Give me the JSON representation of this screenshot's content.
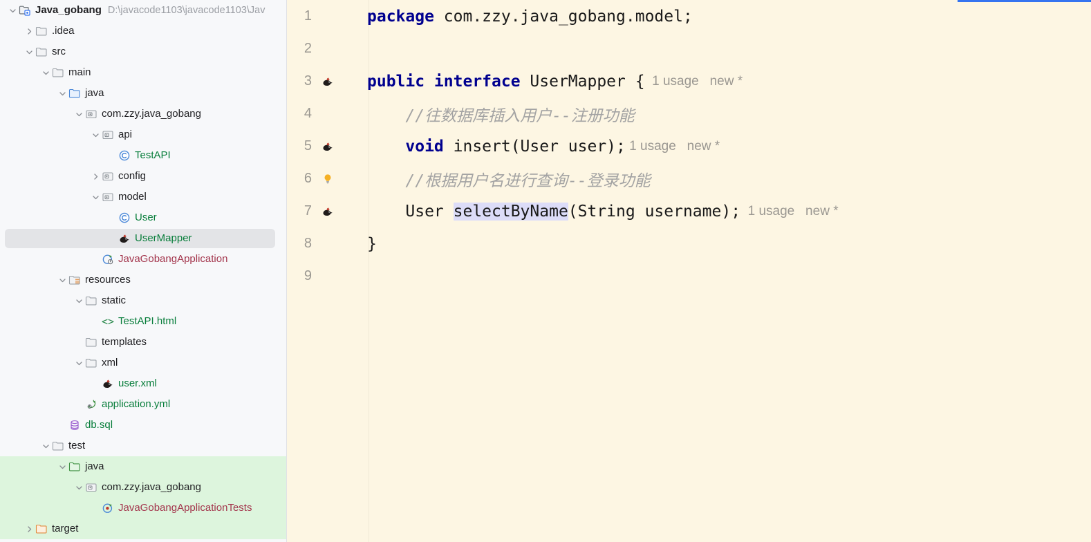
{
  "window": {
    "theme_accent": "#3574f0",
    "editor_background": "#fdf6e3",
    "sidebar_background": "#f7f8fa",
    "selection_background": "#e3e4e7",
    "test_scope_background": "#ddf5dd",
    "identifier_highlight": "#dcdcf8"
  },
  "sidebar": {
    "name": "project-tool-window",
    "items": [
      {
        "label": "Java_gobang",
        "path": "D:\\javacode1103\\javacode1103\\Jav",
        "icon": "project-module-icon",
        "indent": 0,
        "arrow": "expanded",
        "bold": true,
        "color": "#1f1f22",
        "selected": false,
        "testscope": false
      },
      {
        "label": ".idea",
        "path": "",
        "icon": "folder-icon",
        "indent": 1,
        "arrow": "collapsed",
        "bold": false,
        "color": "#1f1f22",
        "selected": false,
        "testscope": false
      },
      {
        "label": "src",
        "path": "",
        "icon": "folder-icon",
        "indent": 1,
        "arrow": "expanded",
        "bold": false,
        "color": "#1f1f22",
        "selected": false,
        "testscope": false
      },
      {
        "label": "main",
        "path": "",
        "icon": "folder-icon",
        "indent": 2,
        "arrow": "expanded",
        "bold": false,
        "color": "#1f1f22",
        "selected": false,
        "testscope": false
      },
      {
        "label": "java",
        "path": "",
        "icon": "source-root-folder-icon",
        "indent": 3,
        "arrow": "expanded",
        "bold": false,
        "color": "#1f1f22",
        "selected": false,
        "testscope": false
      },
      {
        "label": "com.zzy.java_gobang",
        "path": "",
        "icon": "package-icon",
        "indent": 4,
        "arrow": "expanded",
        "bold": false,
        "color": "#1f1f22",
        "selected": false,
        "testscope": false
      },
      {
        "label": "api",
        "path": "",
        "icon": "package-icon",
        "indent": 5,
        "arrow": "expanded",
        "bold": false,
        "color": "#1f1f22",
        "selected": false,
        "testscope": false
      },
      {
        "label": "TestAPI",
        "path": "",
        "icon": "java-class-icon",
        "indent": 6,
        "arrow": "none",
        "bold": false,
        "color": "#077d3a",
        "selected": false,
        "testscope": false
      },
      {
        "label": "config",
        "path": "",
        "icon": "package-icon",
        "indent": 5,
        "arrow": "collapsed",
        "bold": false,
        "color": "#1f1f22",
        "selected": false,
        "testscope": false
      },
      {
        "label": "model",
        "path": "",
        "icon": "package-icon",
        "indent": 5,
        "arrow": "expanded",
        "bold": false,
        "color": "#1f1f22",
        "selected": false,
        "testscope": false
      },
      {
        "label": "User",
        "path": "",
        "icon": "java-class-icon",
        "indent": 6,
        "arrow": "none",
        "bold": false,
        "color": "#077d3a",
        "selected": false,
        "testscope": false
      },
      {
        "label": "UserMapper",
        "path": "",
        "icon": "mybatis-mapper-icon",
        "indent": 6,
        "arrow": "none",
        "bold": false,
        "color": "#077d3a",
        "selected": true,
        "testscope": false
      },
      {
        "label": "JavaGobangApplication",
        "path": "",
        "icon": "spring-boot-run-icon",
        "indent": 5,
        "arrow": "none",
        "bold": false,
        "color": "#a3354c",
        "selected": false,
        "testscope": false
      },
      {
        "label": "resources",
        "path": "",
        "icon": "resources-root-folder-icon",
        "indent": 3,
        "arrow": "expanded",
        "bold": false,
        "color": "#1f1f22",
        "selected": false,
        "testscope": false
      },
      {
        "label": "static",
        "path": "",
        "icon": "folder-icon",
        "indent": 4,
        "arrow": "expanded",
        "bold": false,
        "color": "#1f1f22",
        "selected": false,
        "testscope": false
      },
      {
        "label": "TestAPI.html",
        "path": "",
        "icon": "html-file-icon",
        "indent": 5,
        "arrow": "none",
        "bold": false,
        "color": "#077d3a",
        "selected": false,
        "testscope": false
      },
      {
        "label": "templates",
        "path": "",
        "icon": "folder-icon",
        "indent": 4,
        "arrow": "none",
        "bold": false,
        "color": "#1f1f22",
        "selected": false,
        "testscope": false
      },
      {
        "label": "xml",
        "path": "",
        "icon": "folder-icon",
        "indent": 4,
        "arrow": "expanded",
        "bold": false,
        "color": "#1f1f22",
        "selected": false,
        "testscope": false
      },
      {
        "label": "user.xml",
        "path": "",
        "icon": "mybatis-mapper-icon",
        "indent": 5,
        "arrow": "none",
        "bold": false,
        "color": "#077d3a",
        "selected": false,
        "testscope": false
      },
      {
        "label": "application.yml",
        "path": "",
        "icon": "spring-yaml-icon",
        "indent": 4,
        "arrow": "none",
        "bold": false,
        "color": "#077d3a",
        "selected": false,
        "testscope": false
      },
      {
        "label": "db.sql",
        "path": "",
        "icon": "sql-file-icon",
        "indent": 3,
        "arrow": "none",
        "bold": false,
        "color": "#077d3a",
        "selected": false,
        "testscope": false
      },
      {
        "label": "test",
        "path": "",
        "icon": "folder-icon",
        "indent": 2,
        "arrow": "expanded",
        "bold": false,
        "color": "#1f1f22",
        "selected": false,
        "testscope": false
      },
      {
        "label": "java",
        "path": "",
        "icon": "test-source-root-folder-icon",
        "indent": 3,
        "arrow": "expanded",
        "bold": false,
        "color": "#1f1f22",
        "selected": false,
        "testscope": true
      },
      {
        "label": "com.zzy.java_gobang",
        "path": "",
        "icon": "package-icon",
        "indent": 4,
        "arrow": "expanded",
        "bold": false,
        "color": "#1f1f22",
        "selected": false,
        "testscope": true
      },
      {
        "label": "JavaGobangApplicationTests",
        "path": "",
        "icon": "spring-boot-test-run-icon",
        "indent": 5,
        "arrow": "none",
        "bold": false,
        "color": "#a3354c",
        "selected": false,
        "testscope": true
      },
      {
        "label": "target",
        "path": "",
        "icon": "excluded-folder-icon",
        "indent": 1,
        "arrow": "collapsed",
        "bold": false,
        "color": "#1f1f22",
        "selected": false,
        "testscope": true
      }
    ]
  },
  "editor": {
    "name": "code-editor",
    "file_language": "java",
    "lines": [
      {
        "num": "1",
        "gutter": "none",
        "tokens": [
          {
            "text": "package",
            "style": "kw"
          },
          {
            "text": " com.zzy.java_gobang.model;",
            "style": "plain"
          }
        ]
      },
      {
        "num": "2",
        "gutter": "none",
        "tokens": []
      },
      {
        "num": "3",
        "gutter": "mybatis-mapper-icon",
        "tokens": [
          {
            "text": "public interface",
            "style": "kw"
          },
          {
            "text": " UserMapper {",
            "style": "plain"
          },
          {
            "text": "  1 usage",
            "style": "hint"
          },
          {
            "text": "   new *",
            "style": "hint"
          }
        ]
      },
      {
        "num": "4",
        "gutter": "none",
        "tokens": [
          {
            "text": "    //往数据库插入用户--注册功能",
            "style": "cmt"
          }
        ]
      },
      {
        "num": "5",
        "gutter": "mybatis-mapper-icon",
        "tokens": [
          {
            "text": "    ",
            "style": "plain"
          },
          {
            "text": "void",
            "style": "kw"
          },
          {
            "text": " insert(User user);",
            "style": "plain"
          },
          {
            "text": " 1 usage",
            "style": "hint"
          },
          {
            "text": "   new *",
            "style": "hint"
          }
        ]
      },
      {
        "num": "6",
        "gutter": "intention-bulb-icon",
        "tokens": [
          {
            "text": "    //根据用户名进行查询--登录功能",
            "style": "cmt"
          }
        ]
      },
      {
        "num": "7",
        "gutter": "mybatis-mapper-icon",
        "tokens": [
          {
            "text": "    User ",
            "style": "plain"
          },
          {
            "text": "selectByName",
            "style": "plain highlighted"
          },
          {
            "text": "(String username);",
            "style": "plain"
          },
          {
            "text": "  1 usage",
            "style": "hint"
          },
          {
            "text": "   new *",
            "style": "hint"
          }
        ]
      },
      {
        "num": "8",
        "gutter": "none",
        "tokens": [
          {
            "text": "}",
            "style": "plain"
          }
        ]
      },
      {
        "num": "9",
        "gutter": "none",
        "tokens": []
      }
    ]
  }
}
